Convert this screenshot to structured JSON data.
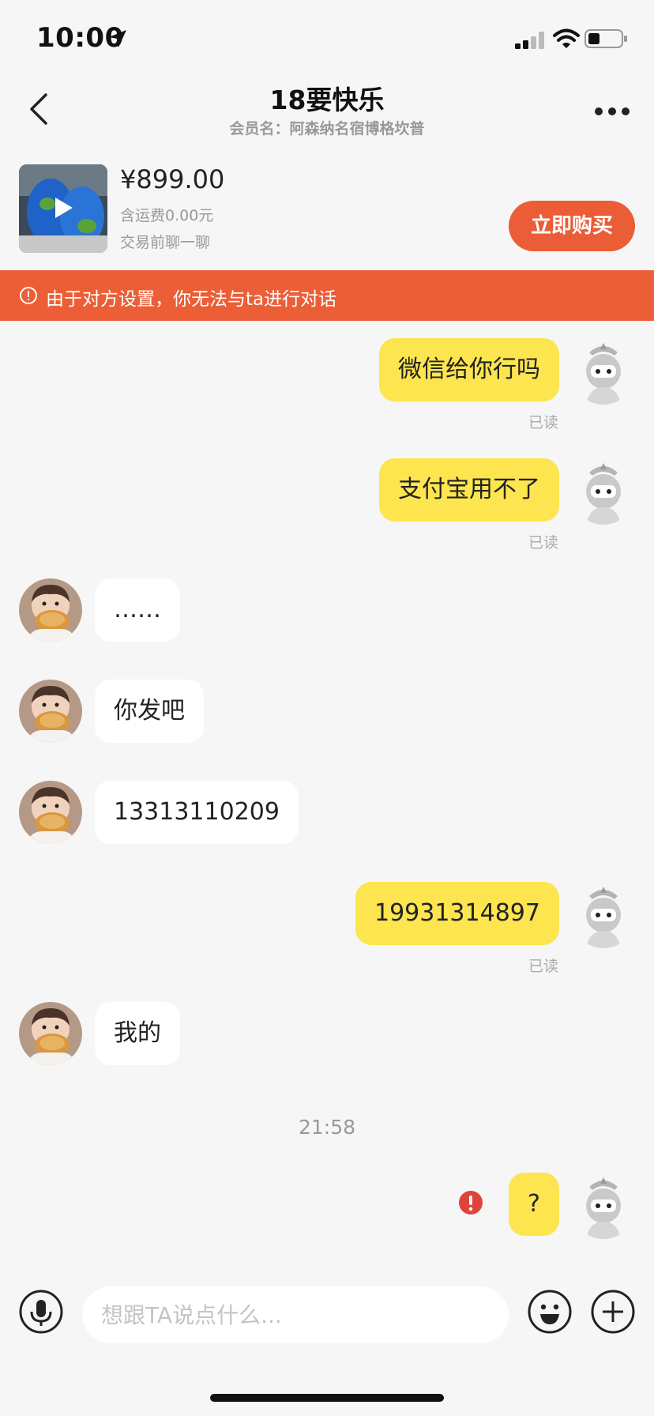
{
  "status_bar": {
    "time": "10:00"
  },
  "header": {
    "title": "18要快乐",
    "subtitle": "会员名：阿森纳名宿博格坎普"
  },
  "product": {
    "price": "¥899.00",
    "shipping": "含运费0.00元",
    "hint": "交易前聊一聊",
    "buy_label": "立即购买"
  },
  "banner": {
    "text": "由于对方设置，你无法与ta进行对话"
  },
  "messages": [
    {
      "sender": "me",
      "text": "微信给你行吗",
      "read": "已读"
    },
    {
      "sender": "me",
      "text": "支付宝用不了",
      "read": "已读"
    },
    {
      "sender": "them",
      "text": "……"
    },
    {
      "sender": "them",
      "text": "你发吧"
    },
    {
      "sender": "them",
      "text": "13313110209"
    },
    {
      "sender": "me",
      "text": "19931314897",
      "read": "已读"
    },
    {
      "sender": "them",
      "text": "我的"
    },
    {
      "sender": "me",
      "text": "?",
      "status": "failed"
    }
  ],
  "time_separator": "21:58",
  "input": {
    "placeholder": "想跟TA说点什么..."
  },
  "colors": {
    "accent": "#ea5d36",
    "my_bubble": "#fce54f",
    "error": "#e0433b"
  }
}
